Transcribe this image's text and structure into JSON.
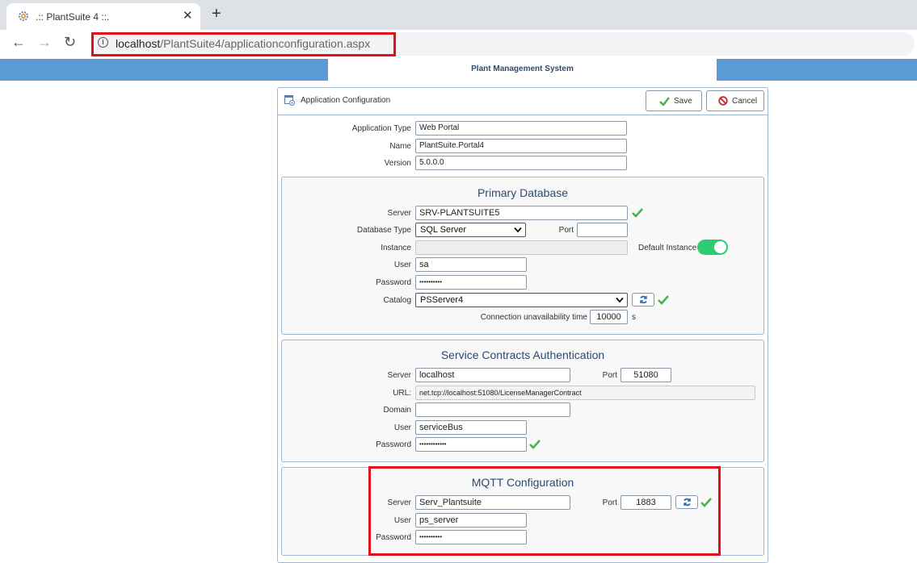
{
  "browser": {
    "tab_title": ".:: PlantSuite 4 ::.",
    "close_glyph": "✕",
    "new_tab_glyph": "+",
    "back_glyph": "←",
    "forward_glyph": "→",
    "reload_glyph": "↻",
    "info_glyph": "i",
    "url_host": "localhost",
    "url_path": "/PlantSuite4/applicationconfiguration.aspx"
  },
  "app": {
    "title": "Plant Management System"
  },
  "panel": {
    "title": "Application Configuration",
    "save_label": "Save",
    "cancel_label": "Cancel"
  },
  "general": {
    "app_type_label": "Application Type",
    "app_type_value": "Web Portal",
    "name_label": "Name",
    "name_value": "PlantSuite.Portal4",
    "version_label": "Version",
    "version_value": "5.0.0.0"
  },
  "primary_db": {
    "title": "Primary Database",
    "server_label": "Server",
    "server_value": "SRV-PLANTSUITE5",
    "dbtype_label": "Database Type",
    "dbtype_value": "SQL Server",
    "port_label": "Port",
    "port_value": "",
    "instance_label": "Instance",
    "instance_value": "",
    "default_instance_label": "Default Instance",
    "default_instance_on": true,
    "user_label": "User",
    "user_value": "sa",
    "password_label": "Password",
    "password_value": "••••••••••",
    "catalog_label": "Catalog",
    "catalog_value": "PSServer4",
    "conn_unavail_label": "Connection unavailability time",
    "conn_unavail_value": "10000",
    "conn_unavail_unit": "s"
  },
  "service_contracts": {
    "title": "Service Contracts Authentication",
    "server_label": "Server",
    "server_value": "localhost",
    "port_label": "Port",
    "port_value": "51080",
    "url_label": "URL:",
    "url_value": "net.tcp://localhost:51080/LicenseManagerContract",
    "domain_label": "Domain",
    "domain_value": "",
    "user_label": "User",
    "user_value": "serviceBus",
    "password_label": "Password",
    "password_value": "••••••••••••"
  },
  "mqtt": {
    "title": "MQTT Configuration",
    "server_label": "Server",
    "server_value": "Serv_Plantsuite",
    "port_label": "Port",
    "port_value": "1883",
    "user_label": "User",
    "user_value": "ps_server",
    "password_label": "Password",
    "password_value": "••••••••••"
  },
  "colors": {
    "accent_blue": "#5b9bd5",
    "highlight_red": "#e0101a",
    "success_green": "#2ecc71"
  }
}
